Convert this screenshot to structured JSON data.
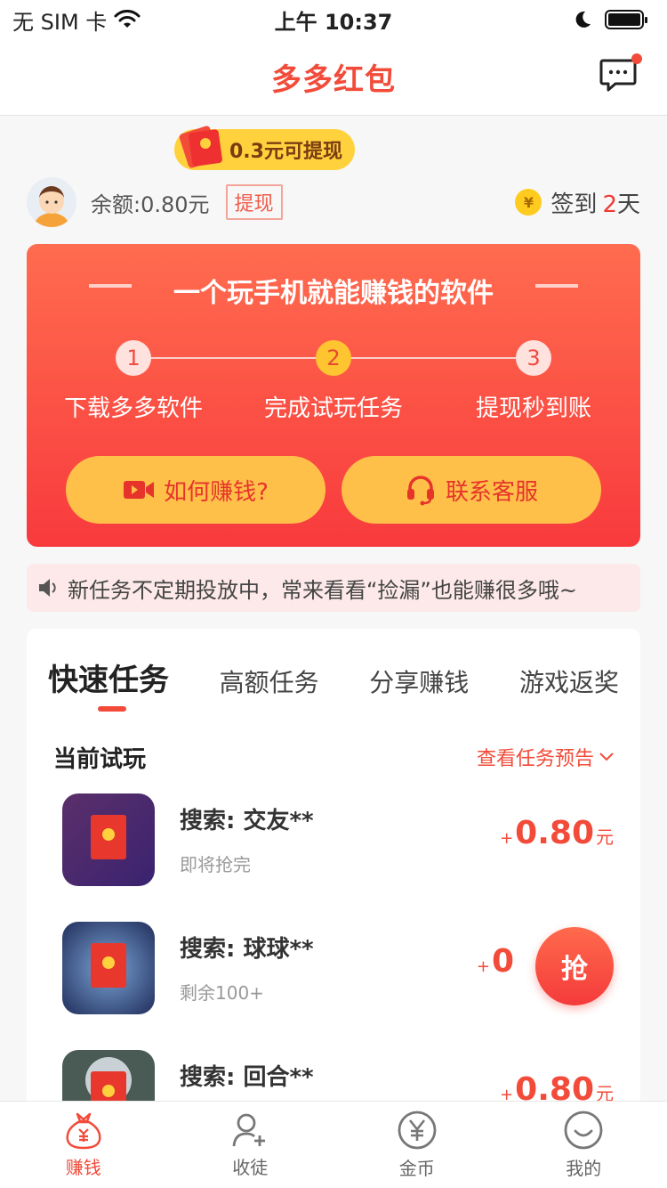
{
  "status_bar": {
    "carrier": "无 SIM 卡",
    "time": "上午 10:37"
  },
  "nav": {
    "title": "多多红包"
  },
  "tip": {
    "text": "0.3元可提现"
  },
  "user": {
    "balance": "余额:0.80元",
    "withdraw": "提现",
    "checkin_prefix": "签到",
    "checkin_days": "2",
    "checkin_suffix": "天",
    "coin_symbol": "¥"
  },
  "banner": {
    "title": "一个玩手机就能赚钱的软件",
    "steps": [
      {
        "num": "1",
        "label": "下载多多软件"
      },
      {
        "num": "2",
        "label": "完成试玩任务"
      },
      {
        "num": "3",
        "label": "提现秒到账"
      }
    ],
    "btn_how": "如何赚钱?",
    "btn_service": "联系客服"
  },
  "notice": {
    "text": "新任务不定期投放中，常来看看“捡漏”也能赚很多哦~"
  },
  "tabs": [
    "快速任务",
    "高额任务",
    "分享赚钱",
    "游戏返奖"
  ],
  "section": {
    "title": "当前试玩",
    "preview": "查看任务预告"
  },
  "tasks": [
    {
      "name": "搜索: 交友**",
      "sub": "即将抢完",
      "plus": "+",
      "amount": "0.80",
      "unit": "元"
    },
    {
      "name": "搜索: 球球**",
      "sub": "剩余100+",
      "plus": "+",
      "amount": "0",
      "unit": ""
    },
    {
      "name": "搜索: 回合**",
      "sub": "",
      "plus": "+",
      "amount": "0.80",
      "unit": "元"
    }
  ],
  "grab": {
    "label": "抢"
  },
  "tabbar": [
    "赚钱",
    "收徒",
    "金币",
    "我的"
  ],
  "colors": {
    "accent": "#f24b3a",
    "banner_top": "#ff6c4f",
    "banner_bottom": "#f83a3d",
    "button_yellow": "#ffc04a"
  }
}
